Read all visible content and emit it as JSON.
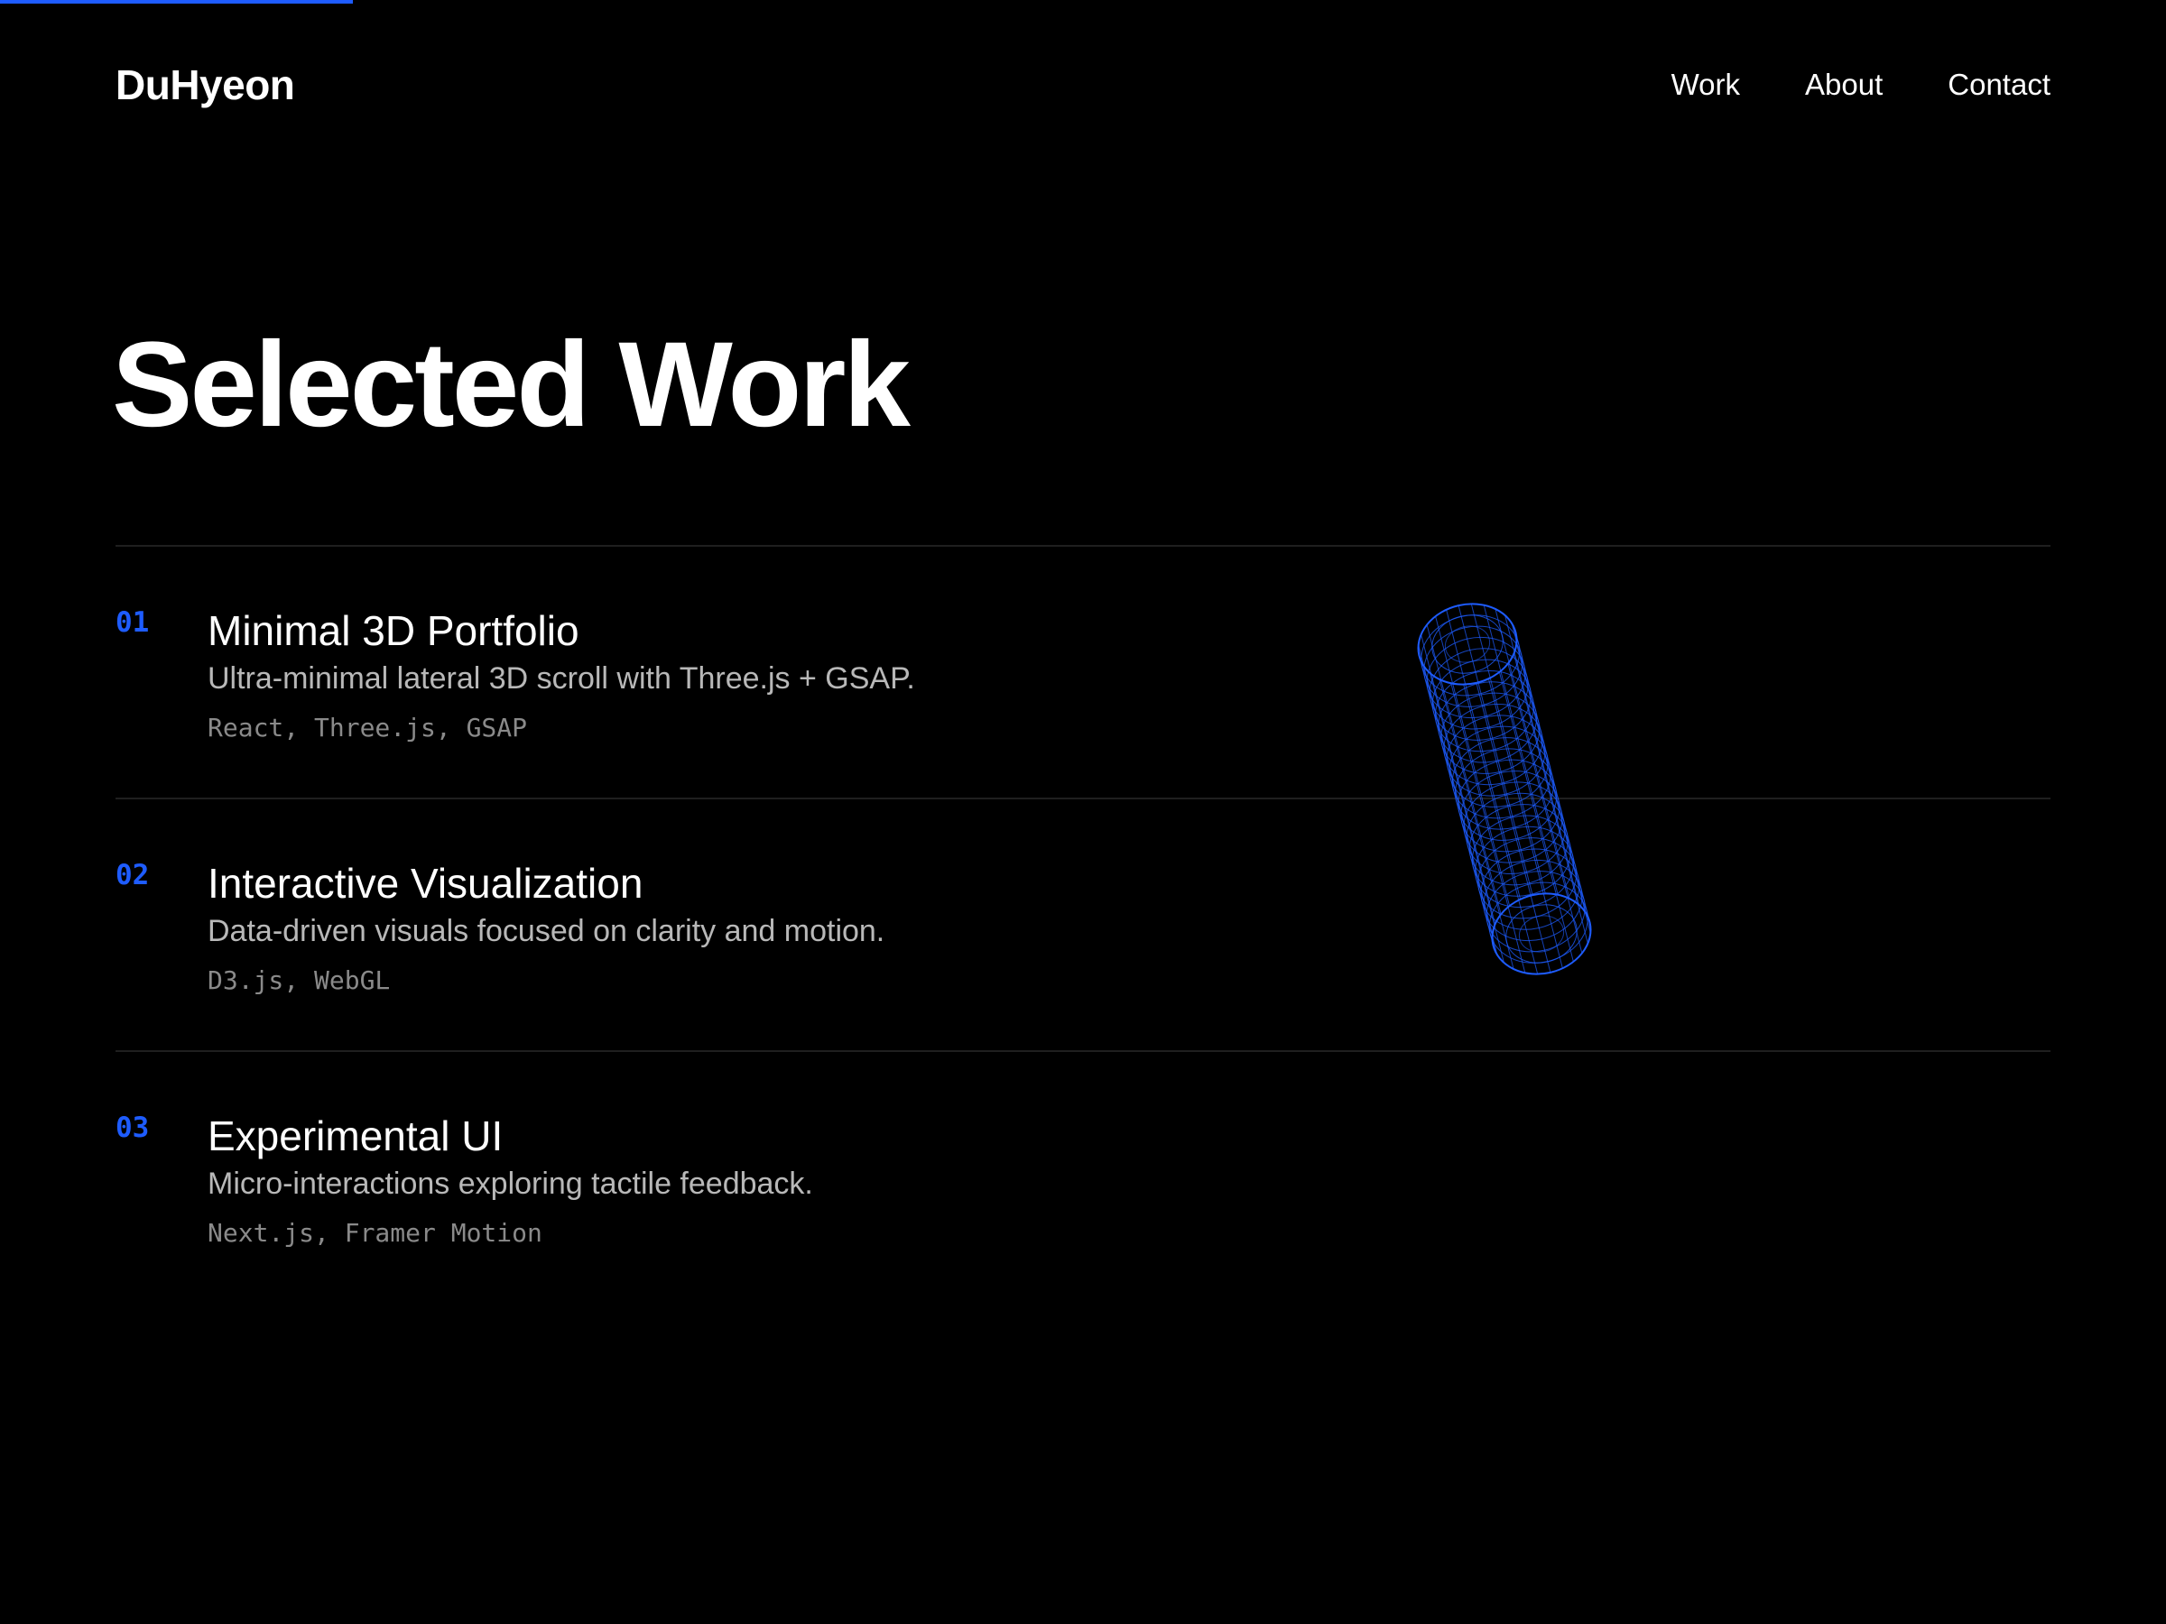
{
  "progress": {
    "fraction": 0.163,
    "color": "#1e5cff"
  },
  "header": {
    "logo": "DuHyeon",
    "nav": [
      {
        "label": "Work"
      },
      {
        "label": "About"
      },
      {
        "label": "Contact"
      }
    ]
  },
  "main": {
    "title": "Selected Work",
    "projects": [
      {
        "number": "01",
        "title": "Minimal 3D Portfolio",
        "description": "Ultra-minimal lateral 3D scroll with Three.js + GSAP.",
        "tags": "React, Three.js, GSAP"
      },
      {
        "number": "02",
        "title": "Interactive Visualization",
        "description": "Data-driven visuals focused on clarity and motion.",
        "tags": "D3.js, WebGL"
      },
      {
        "number": "03",
        "title": "Experimental UI",
        "description": "Micro-interactions exploring tactile feedback.",
        "tags": "Next.js, Framer Motion"
      }
    ]
  },
  "visual": {
    "icon": "wireframe-cylinder-icon",
    "color": "#1e5cff"
  }
}
